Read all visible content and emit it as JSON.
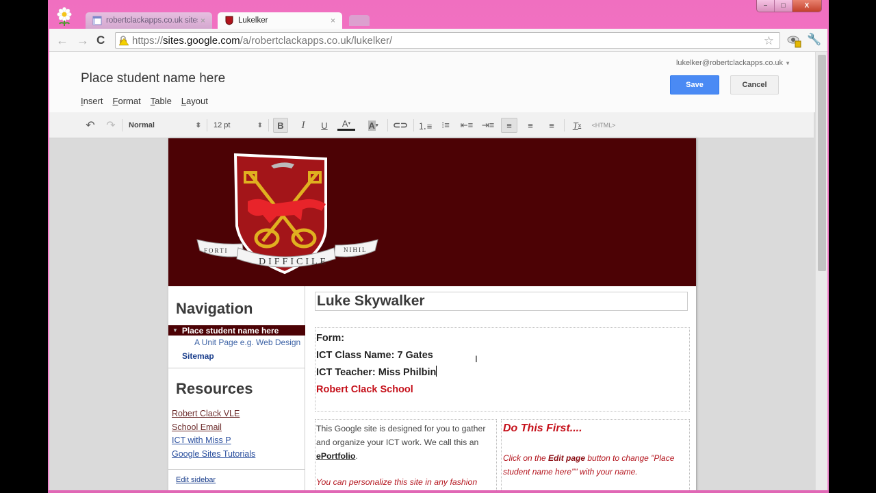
{
  "browser": {
    "tabs": [
      {
        "label": "robertclackapps.co.uk sites",
        "active": false
      },
      {
        "label": "Lukelker",
        "active": true
      }
    ],
    "url_prefix": "https://",
    "url_domain": "sites.google.com",
    "url_path": "/a/robertclackapps.co.uk/lukelker/",
    "window_controls": {
      "minimize": "–",
      "maximize": "□",
      "close": "X"
    }
  },
  "editor": {
    "page_name": "Place student name here",
    "menu": [
      "Insert",
      "Format",
      "Table",
      "Layout"
    ],
    "account": "lukelker@robertclackapps.co.uk",
    "save_label": "Save",
    "cancel_label": "Cancel",
    "toolbar": {
      "style_value": "Normal",
      "size_value": "12 pt",
      "html_label": "<HTML>",
      "bold_active": true,
      "align_left_active": true
    }
  },
  "site": {
    "motto": [
      "FORTI",
      "DIFFICILE",
      "NIHIL"
    ],
    "banner_color": "#4c0205",
    "accent_red": "#c5101a",
    "sidebar": {
      "nav_heading": "Navigation",
      "nav_current": "Place student name here",
      "nav_sub": "A Unit Page e.g. Web Design",
      "nav_sitemap": "Sitemap",
      "res_heading": "Resources",
      "resources": [
        {
          "label": "Robert Clack VLE",
          "color": "#6b2a2a"
        },
        {
          "label": "School Email",
          "color": "#6b2a2a"
        },
        {
          "label": "ICT with Miss P",
          "color": "#2a4f9e"
        },
        {
          "label": "Google Sites Tutorials",
          "color": "#2a4f9e"
        }
      ],
      "edit_sidebar": "Edit sidebar"
    },
    "main": {
      "title": "Luke Skywalker",
      "form_label": "Form:",
      "class_line": "ICT Class Name: 7 Gates",
      "teacher_line": "ICT Teacher: Miss Philbin",
      "school": "Robert Clack School",
      "intro_1": "This Google site is designed for you to gather and organize your ICT work. We call this an ",
      "intro_bold": "ePortfolio",
      "intro_end": ".",
      "intro_italic": "You can personalize this site in any fashion",
      "first_heading": "Do This First....",
      "first_pre": "Click on the ",
      "first_bold": "Edit page",
      "first_post": " button to change \"Place student name here\"\" with your name."
    }
  }
}
